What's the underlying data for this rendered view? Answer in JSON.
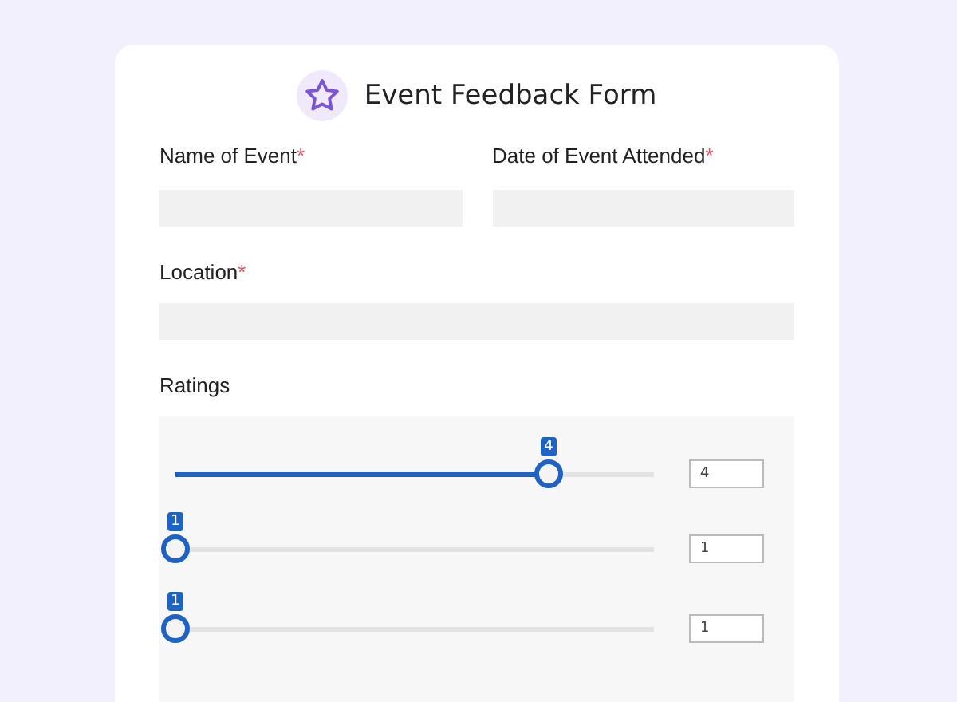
{
  "form": {
    "title": "Event Feedback Form"
  },
  "fields_row": [
    {
      "label": "Name of Event",
      "required_mark": "*"
    },
    {
      "label": "Date of Event Attended",
      "required_mark": "*"
    }
  ],
  "location": {
    "label": "Location",
    "required_mark": "*"
  },
  "ratings": {
    "label": "Ratings",
    "sliders": [
      {
        "level": 0.78,
        "bubble": "4",
        "value": "4"
      },
      {
        "level": 0,
        "bubble": "1",
        "value": "1"
      },
      {
        "level": 0,
        "bubble": "1",
        "value": "1"
      }
    ]
  }
}
